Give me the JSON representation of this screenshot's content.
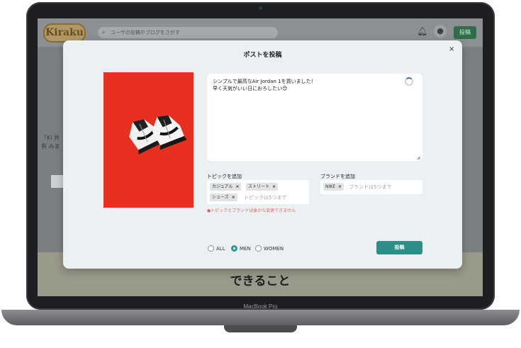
{
  "device_label": "MacBook Pro",
  "app": {
    "logo_text": "Kiraku",
    "search_placeholder": "ユーザの投稿やブログをさがす",
    "header_post_button": "投稿",
    "side_text": "「Ki 共有 みま",
    "section_title": "できること"
  },
  "modal": {
    "title": "ポストを投稿",
    "close": "×",
    "post_text_line1": "シンプルで最高なAir Jordan 1を買いました！",
    "post_text_line2": "早く天気がいい日におろしたい😊",
    "topics_label": "トピックを追加",
    "topics": [
      "カジュアル",
      "ストリート",
      "シューズ"
    ],
    "topics_placeholder": "トピックは5つまで",
    "brands_label": "ブランドを追加",
    "brands": [
      "NIKE"
    ],
    "brands_placeholder": "ブランドは5つまで",
    "warning": "●トピックとブランドは後から変更できません",
    "audience_options": [
      "ALL",
      "MEN",
      "WOMEN"
    ],
    "audience_selected": "MEN",
    "submit_label": "投稿"
  },
  "colors": {
    "accent": "#2d9a92",
    "photo_background": "#e7301f",
    "warning": "#e0675e"
  }
}
